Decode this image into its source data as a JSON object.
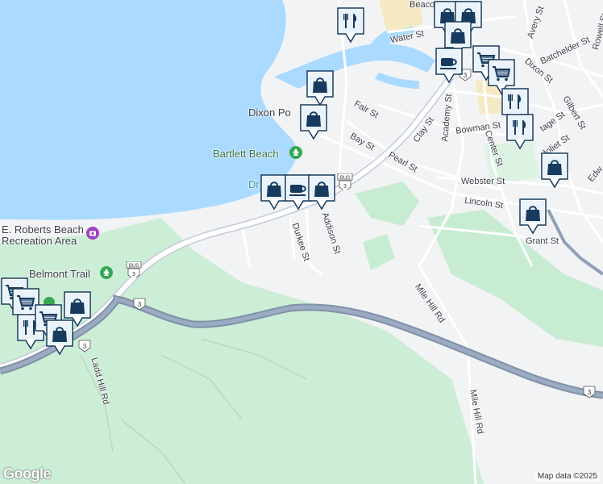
{
  "map": {
    "labels": {
      "beacon": "Beacon",
      "water_st": "Water St",
      "dixon_point": "Dixon Po",
      "fair_st": "Fair St",
      "bartlett_beach": "Bartlett Beach",
      "bay_st": "Bay St",
      "pearl_st": "Pearl St",
      "clay_st": "Clay St",
      "academy_st": "Academy St",
      "bowman_st": "Bowman St",
      "center_st": "Center St",
      "webster_st": "Webster St",
      "lincoln_st": "Lincoln St",
      "grant_st": "Grant St",
      "addison_st": "Addison St",
      "durkee_st": "Durkee St",
      "roberts_beach": "E. Roberts Beach",
      "recreation_area": "Recreation Area",
      "belmont_trail": "Belmont Trail",
      "ladd_hill_rd": "Ladd Hill Rd",
      "mile_hill_rd_1": "Mile Hill Rd",
      "mile_hill_rd_2": "Mile Hill Rd",
      "avery_st": "Avery St",
      "rowell_st": "Rowell St",
      "batchelder_st": "Batchelder St",
      "dixon_st": "Dixon St",
      "gilbert_st": "Gilbert St",
      "joliet_st": "Joliet St",
      "edw": "Edw",
      "dr": "Dr",
      "tage_st": "tage St"
    },
    "shields": {
      "us3": "3",
      "bus": "BUS"
    },
    "attribution": "Map data ©2025",
    "logo": "Google",
    "colors": {
      "water": "#aadaff",
      "park": "#c8ecd2",
      "highway": "#8a9bb3",
      "pin": "#173b5e"
    }
  },
  "pins": [
    {
      "name": "restaurant-pin",
      "icon": "restaurant-icon"
    },
    {
      "name": "shopping-pin",
      "icon": "shopping-bag-icon"
    },
    {
      "name": "grocery-pin",
      "icon": "shopping-cart-icon"
    },
    {
      "name": "cafe-pin",
      "icon": "coffee-cup-icon"
    }
  ]
}
